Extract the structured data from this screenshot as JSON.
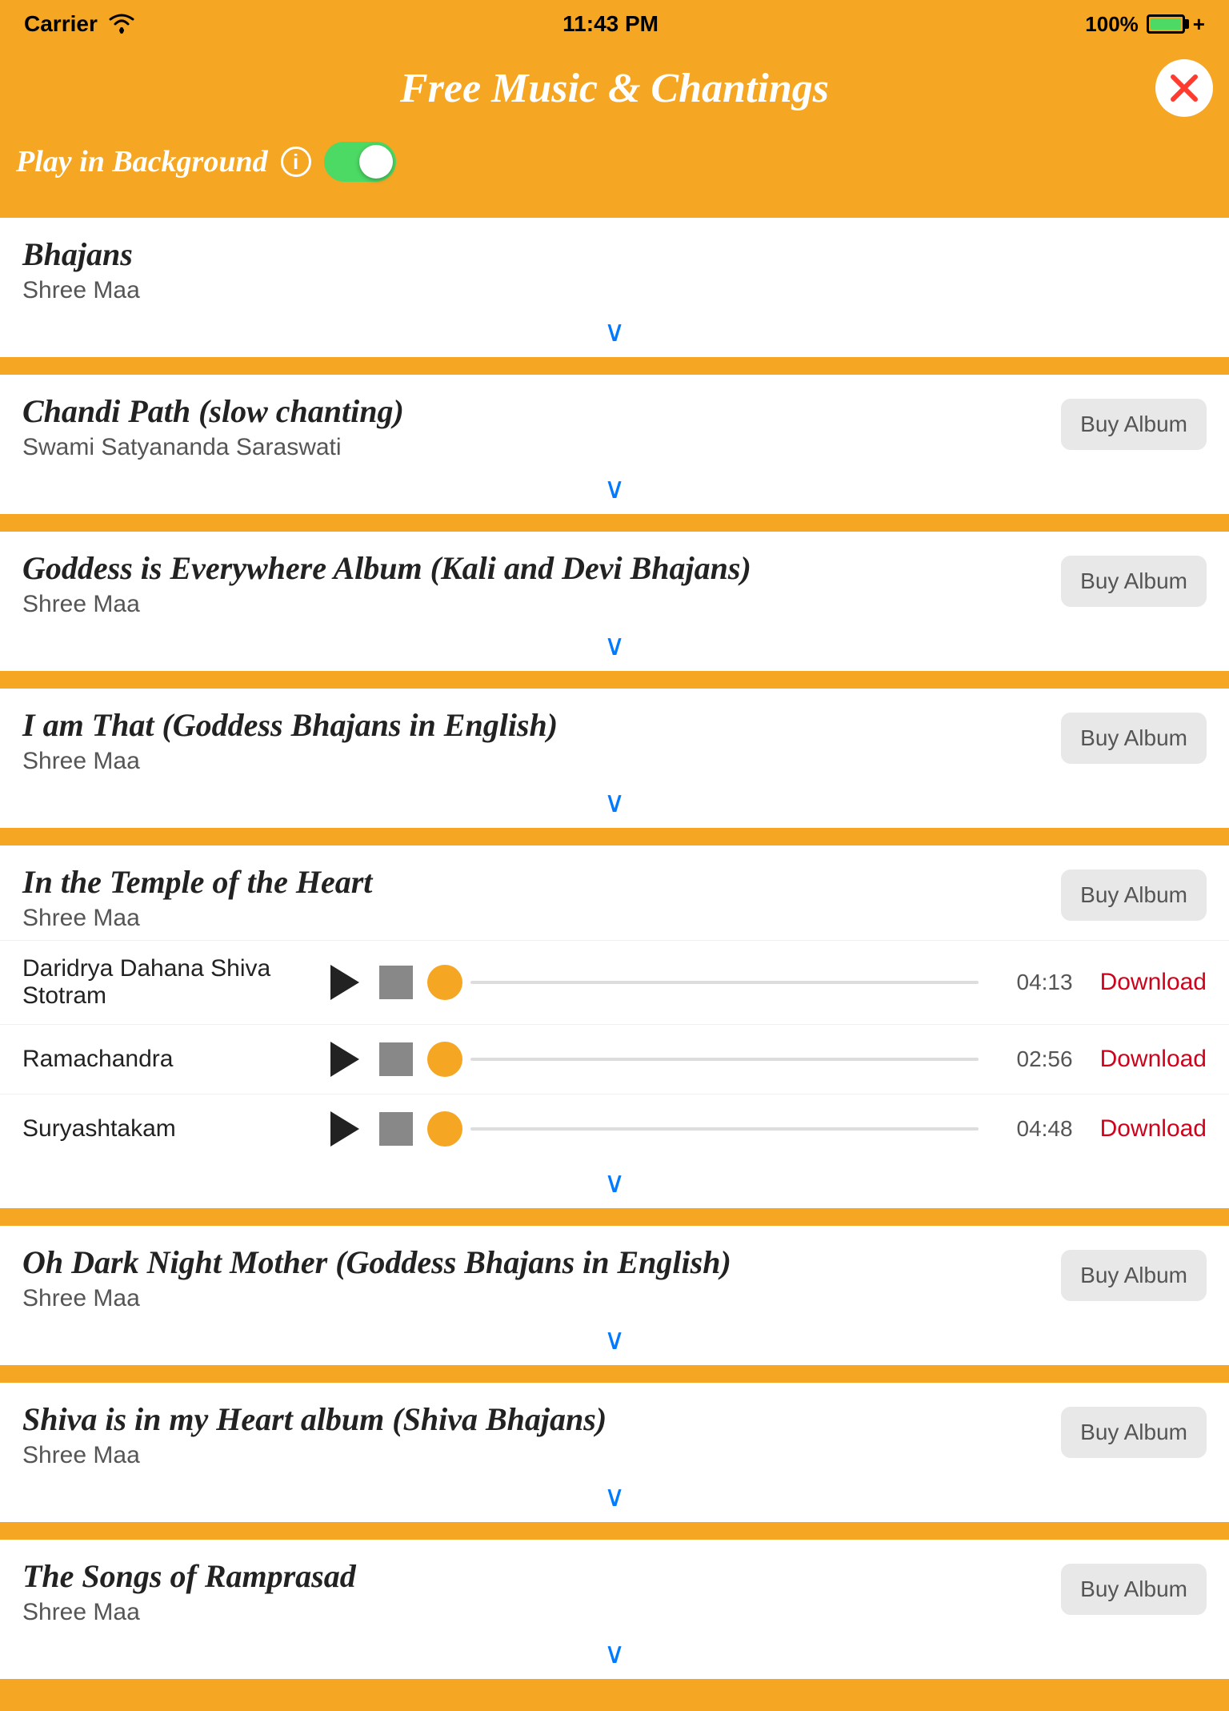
{
  "statusBar": {
    "carrier": "Carrier",
    "wifi": "wifi",
    "time": "11:43 PM",
    "battery": "100%",
    "plus": "+"
  },
  "header": {
    "title": "Free Music & Chantings",
    "closeLabel": "✕"
  },
  "controls": {
    "playBgLabel": "Play in Background",
    "infoIcon": "i",
    "toggleOn": true
  },
  "albums": [
    {
      "id": "bhajans",
      "title": "Bhajans",
      "artist": "Shree Maa",
      "hasBuyAlbum": false,
      "tracks": []
    },
    {
      "id": "chandi-path",
      "title": "Chandi Path (slow chanting)",
      "artist": "Swami Satyananda Saraswati",
      "hasBuyAlbum": true,
      "buyLabel": "Buy Album",
      "tracks": []
    },
    {
      "id": "goddess-everywhere",
      "title": "Goddess is Everywhere Album (Kali and Devi Bhajans)",
      "artist": "Shree Maa",
      "hasBuyAlbum": true,
      "buyLabel": "Buy Album",
      "tracks": []
    },
    {
      "id": "i-am-that",
      "title": "I am That (Goddess Bhajans in English)",
      "artist": "Shree Maa",
      "hasBuyAlbum": true,
      "buyLabel": "Buy Album",
      "tracks": []
    },
    {
      "id": "temple-heart",
      "title": "In the Temple of the Heart",
      "artist": "Shree Maa",
      "hasBuyAlbum": true,
      "buyLabel": "Buy Album",
      "tracks": [
        {
          "name": "Daridrya Dahana Shiva Stotram",
          "duration": "04:13",
          "downloadLabel": "Download"
        },
        {
          "name": "Ramachandra",
          "duration": "02:56",
          "downloadLabel": "Download"
        },
        {
          "name": "Suryashtakam",
          "duration": "04:48",
          "downloadLabel": "Download"
        }
      ]
    },
    {
      "id": "oh-dark-night",
      "title": "Oh Dark Night Mother (Goddess Bhajans in English)",
      "artist": "Shree Maa",
      "hasBuyAlbum": true,
      "buyLabel": "Buy Album",
      "tracks": []
    },
    {
      "id": "shiva-heart",
      "title": "Shiva is in my Heart album (Shiva Bhajans)",
      "artist": "Shree Maa",
      "hasBuyAlbum": true,
      "buyLabel": "Buy Album",
      "tracks": []
    },
    {
      "id": "ramprasad",
      "title": "The Songs of Ramprasad",
      "artist": "Shree Maa",
      "hasBuyAlbum": true,
      "buyLabel": "Buy Album",
      "tracks": []
    }
  ],
  "ui": {
    "chevron": "∨",
    "playIcon": "▶",
    "stopColor": "#888888",
    "knobColor": "#f5a623"
  }
}
